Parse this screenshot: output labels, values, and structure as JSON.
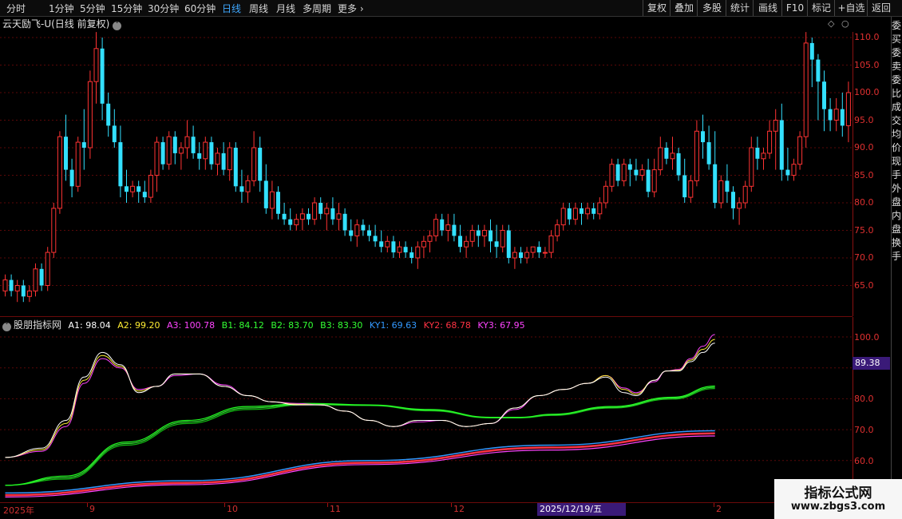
{
  "toolbar": {
    "periods": [
      "分时",
      "1分钟",
      "5分钟",
      "15分钟",
      "30分钟",
      "60分钟",
      "日线",
      "周线",
      "月线",
      "多周期",
      "更多"
    ],
    "active": "日线",
    "right_buttons": [
      "复权",
      "叠加",
      "多股",
      "统计",
      "画线",
      "F10",
      "标记",
      "+自选",
      "返回"
    ]
  },
  "main": {
    "title": "云天励飞-U(日线 前复权)",
    "ticks": [
      "110.0",
      "105.0",
      "100.0",
      "95.0",
      "90.0",
      "85.0",
      "80.0",
      "75.0",
      "70.0",
      "65.0"
    ]
  },
  "indicator": {
    "name": "股朋指标网",
    "values": [
      {
        "label": "A1: 98.04",
        "color": "#ffffff"
      },
      {
        "label": "A2: 99.20",
        "color": "#ffee33"
      },
      {
        "label": "A3: 100.78",
        "color": "#ff44ff"
      },
      {
        "label": "B1: 84.12",
        "color": "#33ff33"
      },
      {
        "label": "B2: 83.70",
        "color": "#33ff33"
      },
      {
        "label": "B3: 83.30",
        "color": "#33ff33"
      },
      {
        "label": "KY1: 69.63",
        "color": "#3399ff"
      },
      {
        "label": "KY2: 68.78",
        "color": "#ff3344"
      },
      {
        "label": "KY3: 67.95",
        "color": "#ff44ff"
      }
    ],
    "ticks": [
      "100.0",
      "90.0",
      "80.0",
      "70.0",
      "60.0"
    ],
    "current_value": "89.38"
  },
  "xaxis": {
    "labels": [
      {
        "text": "2025年"
      },
      {
        "text": "9"
      },
      {
        "text": "10"
      },
      {
        "text": "11"
      },
      {
        "text": "12"
      },
      {
        "text": "2"
      }
    ],
    "highlight_date": "2025/12/19/五"
  },
  "watermark": {
    "line1": "指标公式网",
    "line2": "www.zbgs3.com"
  },
  "side_panel_text": "委买委卖委比成交均价现手外盘内盘换手",
  "colors": {
    "up": "#ff3333",
    "down": "#33e0ff",
    "background": "#000000",
    "grid": "#5a0808",
    "accent": "#3fa8ff"
  },
  "chart_data": {
    "type": "candlestick",
    "candles_ohlc": [
      [
        64,
        67,
        63,
        66
      ],
      [
        66,
        67,
        63,
        64
      ],
      [
        64,
        66,
        62,
        65
      ],
      [
        65,
        66,
        62,
        63
      ],
      [
        63,
        65,
        62,
        64
      ],
      [
        64,
        69,
        63,
        68
      ],
      [
        68,
        69,
        64,
        65
      ],
      [
        65,
        72,
        64,
        71
      ],
      [
        71,
        80,
        70,
        79
      ],
      [
        79,
        93,
        78,
        92
      ],
      [
        92,
        96,
        84,
        86
      ],
      [
        86,
        88,
        81,
        83
      ],
      [
        83,
        92,
        82,
        91
      ],
      [
        91,
        97,
        86,
        90
      ],
      [
        90,
        104,
        88,
        102
      ],
      [
        102,
        111,
        98,
        108
      ],
      [
        108,
        110,
        95,
        98
      ],
      [
        98,
        100,
        92,
        94
      ],
      [
        94,
        97,
        90,
        91
      ],
      [
        91,
        94,
        81,
        83
      ],
      [
        83,
        86,
        80,
        82
      ],
      [
        82,
        84,
        81,
        83
      ],
      [
        83,
        84,
        80,
        82
      ],
      [
        82,
        84,
        80,
        81
      ],
      [
        81,
        86,
        80,
        85
      ],
      [
        85,
        92,
        82,
        91
      ],
      [
        91,
        92,
        86,
        87
      ],
      [
        87,
        93,
        86,
        92
      ],
      [
        92,
        93,
        87,
        89
      ],
      [
        89,
        91,
        86,
        90
      ],
      [
        90,
        95,
        88,
        92
      ],
      [
        92,
        94,
        88,
        89
      ],
      [
        89,
        91,
        86,
        88
      ],
      [
        88,
        92,
        86,
        91
      ],
      [
        91,
        92,
        86,
        87
      ],
      [
        87,
        90,
        85,
        89
      ],
      [
        89,
        91,
        85,
        86
      ],
      [
        86,
        91,
        84,
        90
      ],
      [
        90,
        91,
        82,
        83
      ],
      [
        83,
        86,
        80,
        82
      ],
      [
        82,
        85,
        80,
        84
      ],
      [
        84,
        93,
        83,
        90
      ],
      [
        90,
        92,
        82,
        84
      ],
      [
        84,
        87,
        78,
        79
      ],
      [
        79,
        84,
        77,
        82
      ],
      [
        82,
        83,
        77,
        78
      ],
      [
        78,
        80,
        76,
        77
      ],
      [
        77,
        79,
        75,
        76
      ],
      [
        76,
        78,
        75,
        77
      ],
      [
        77,
        79,
        75,
        78
      ],
      [
        78,
        79,
        76,
        77
      ],
      [
        77,
        81,
        76,
        80
      ],
      [
        80,
        81,
        77,
        78
      ],
      [
        78,
        80,
        75,
        79
      ],
      [
        79,
        81,
        76,
        77
      ],
      [
        77,
        80,
        75,
        78
      ],
      [
        78,
        79,
        74,
        75
      ],
      [
        75,
        77,
        73,
        74
      ],
      [
        74,
        77,
        72,
        76
      ],
      [
        76,
        77,
        74,
        75
      ],
      [
        75,
        76,
        73,
        74
      ],
      [
        74,
        76,
        72,
        73
      ],
      [
        73,
        75,
        71,
        72
      ],
      [
        72,
        74,
        71,
        73
      ],
      [
        73,
        74,
        70,
        71
      ],
      [
        71,
        73,
        70,
        72
      ],
      [
        72,
        73,
        70,
        71
      ],
      [
        71,
        72,
        69,
        70
      ],
      [
        70,
        73,
        68,
        72
      ],
      [
        72,
        74,
        70,
        73
      ],
      [
        73,
        75,
        71,
        74
      ],
      [
        74,
        78,
        73,
        77
      ],
      [
        77,
        78,
        74,
        75
      ],
      [
        75,
        78,
        73,
        76
      ],
      [
        76,
        78,
        73,
        74
      ],
      [
        74,
        76,
        71,
        72
      ],
      [
        72,
        74,
        70,
        73
      ],
      [
        73,
        76,
        72,
        75
      ],
      [
        75,
        76,
        72,
        74
      ],
      [
        74,
        76,
        72,
        75
      ],
      [
        75,
        77,
        71,
        73
      ],
      [
        73,
        76,
        70,
        72
      ],
      [
        72,
        76,
        71,
        75
      ],
      [
        75,
        76,
        69,
        70
      ],
      [
        70,
        72,
        68,
        71
      ],
      [
        71,
        72,
        69,
        70
      ],
      [
        70,
        72,
        69,
        71
      ],
      [
        71,
        72,
        70,
        72
      ],
      [
        72,
        73,
        70,
        71
      ],
      [
        71,
        72,
        70,
        71
      ],
      [
        71,
        75,
        70,
        74
      ],
      [
        74,
        77,
        73,
        76
      ],
      [
        76,
        80,
        75,
        79
      ],
      [
        79,
        80,
        76,
        77
      ],
      [
        77,
        80,
        76,
        79
      ],
      [
        79,
        80,
        76,
        78
      ],
      [
        78,
        80,
        77,
        79
      ],
      [
        79,
        80,
        77,
        78
      ],
      [
        78,
        81,
        77,
        80
      ],
      [
        80,
        84,
        79,
        83
      ],
      [
        83,
        88,
        82,
        87
      ],
      [
        87,
        88,
        83,
        84
      ],
      [
        84,
        88,
        83,
        87
      ],
      [
        87,
        88,
        83,
        86
      ],
      [
        86,
        88,
        84,
        85
      ],
      [
        85,
        87,
        84,
        86
      ],
      [
        86,
        88,
        81,
        82
      ],
      [
        82,
        88,
        81,
        86
      ],
      [
        86,
        92,
        85,
        90
      ],
      [
        90,
        91,
        87,
        88
      ],
      [
        88,
        92,
        86,
        89
      ],
      [
        89,
        90,
        84,
        85
      ],
      [
        85,
        88,
        80,
        81
      ],
      [
        81,
        85,
        80,
        84
      ],
      [
        84,
        95,
        83,
        93
      ],
      [
        93,
        96,
        88,
        91
      ],
      [
        91,
        94,
        86,
        87
      ],
      [
        87,
        93,
        79,
        80
      ],
      [
        80,
        85,
        79,
        84
      ],
      [
        84,
        87,
        80,
        82
      ],
      [
        82,
        83,
        77,
        79
      ],
      [
        79,
        81,
        76,
        80
      ],
      [
        80,
        84,
        79,
        83
      ],
      [
        83,
        92,
        82,
        90
      ],
      [
        90,
        92,
        86,
        88
      ],
      [
        88,
        90,
        86,
        89
      ],
      [
        89,
        95,
        88,
        93
      ],
      [
        93,
        97,
        86,
        95
      ],
      [
        95,
        98,
        84,
        86
      ],
      [
        86,
        90,
        84,
        85
      ],
      [
        85,
        88,
        84,
        87
      ],
      [
        87,
        93,
        86,
        92
      ],
      [
        92,
        111,
        90,
        109
      ],
      [
        109,
        110,
        101,
        106
      ],
      [
        106,
        107,
        95,
        102
      ],
      [
        102,
        104,
        93,
        97
      ],
      [
        97,
        99,
        93,
        95
      ],
      [
        95,
        99,
        93,
        97
      ],
      [
        97,
        100,
        92,
        94
      ],
      [
        94,
        102,
        91,
        100
      ]
    ],
    "ind_series": {
      "A1": [
        [
          0,
          61
        ],
        [
          6,
          64
        ],
        [
          10,
          73
        ],
        [
          13,
          87
        ],
        [
          16,
          95
        ],
        [
          19,
          91
        ],
        [
          22,
          82
        ],
        [
          25,
          84
        ],
        [
          28,
          88
        ],
        [
          32,
          88
        ],
        [
          36,
          84
        ],
        [
          40,
          81
        ],
        [
          44,
          79
        ],
        [
          48,
          78
        ],
        [
          52,
          78
        ],
        [
          56,
          76
        ],
        [
          60,
          73
        ],
        [
          64,
          71
        ],
        [
          68,
          73
        ],
        [
          72,
          73
        ],
        [
          76,
          71
        ],
        [
          80,
          72
        ],
        [
          84,
          77
        ],
        [
          88,
          81
        ],
        [
          92,
          83
        ],
        [
          96,
          85
        ],
        [
          99,
          87
        ],
        [
          102,
          82
        ],
        [
          104,
          81
        ],
        [
          107,
          86
        ],
        [
          109,
          89
        ],
        [
          111,
          89
        ],
        [
          113,
          92
        ],
        [
          115,
          95
        ],
        [
          117,
          98
        ]
      ],
      "A2": [
        [
          0,
          61
        ],
        [
          6,
          63.5
        ],
        [
          10,
          72
        ],
        [
          13,
          86
        ],
        [
          16,
          94
        ],
        [
          19,
          90.5
        ],
        [
          22,
          82.5
        ],
        [
          25,
          84
        ],
        [
          28,
          88
        ],
        [
          32,
          88
        ],
        [
          36,
          84
        ],
        [
          40,
          81
        ],
        [
          44,
          79
        ],
        [
          48,
          78.2
        ],
        [
          52,
          78
        ],
        [
          56,
          76
        ],
        [
          60,
          73
        ],
        [
          64,
          71
        ],
        [
          68,
          73
        ],
        [
          72,
          73
        ],
        [
          76,
          71
        ],
        [
          80,
          72
        ],
        [
          84,
          77
        ],
        [
          88,
          81
        ],
        [
          92,
          83
        ],
        [
          96,
          85
        ],
        [
          99,
          87.5
        ],
        [
          102,
          83
        ],
        [
          104,
          81.5
        ],
        [
          107,
          86
        ],
        [
          109,
          89
        ],
        [
          111,
          89.2
        ],
        [
          113,
          92.5
        ],
        [
          115,
          96
        ],
        [
          117,
          99.2
        ]
      ],
      "A3": [
        [
          0,
          61
        ],
        [
          6,
          63
        ],
        [
          10,
          71
        ],
        [
          13,
          85
        ],
        [
          16,
          93
        ],
        [
          19,
          90
        ],
        [
          22,
          83
        ],
        [
          25,
          84
        ],
        [
          28,
          87.5
        ],
        [
          32,
          88
        ],
        [
          36,
          84.5
        ],
        [
          40,
          81
        ],
        [
          44,
          79
        ],
        [
          48,
          78.5
        ],
        [
          52,
          78
        ],
        [
          56,
          76
        ],
        [
          60,
          73
        ],
        [
          64,
          71
        ],
        [
          68,
          72.5
        ],
        [
          72,
          73
        ],
        [
          76,
          71
        ],
        [
          80,
          72
        ],
        [
          84,
          76.5
        ],
        [
          88,
          81
        ],
        [
          92,
          83
        ],
        [
          96,
          85
        ],
        [
          99,
          87.5
        ],
        [
          102,
          83.5
        ],
        [
          104,
          82
        ],
        [
          107,
          85.5
        ],
        [
          109,
          89
        ],
        [
          111,
          89.5
        ],
        [
          113,
          93
        ],
        [
          115,
          97
        ],
        [
          117,
          100.78
        ]
      ],
      "B1": [
        [
          0,
          52
        ],
        [
          10,
          55
        ],
        [
          20,
          66
        ],
        [
          30,
          73
        ],
        [
          40,
          77.5
        ],
        [
          50,
          78.5
        ],
        [
          60,
          78
        ],
        [
          70,
          76.5
        ],
        [
          80,
          74
        ],
        [
          85,
          74
        ],
        [
          90,
          75
        ],
        [
          100,
          77.5
        ],
        [
          110,
          80.5
        ],
        [
          117,
          84.12
        ]
      ],
      "B2": [
        [
          0,
          52
        ],
        [
          10,
          54.5
        ],
        [
          20,
          65.5
        ],
        [
          30,
          72.5
        ],
        [
          40,
          77
        ],
        [
          50,
          78.3
        ],
        [
          60,
          77.9
        ],
        [
          70,
          76.3
        ],
        [
          80,
          73.9
        ],
        [
          85,
          73.9
        ],
        [
          90,
          74.8
        ],
        [
          100,
          77.2
        ],
        [
          110,
          80.2
        ],
        [
          117,
          83.7
        ]
      ],
      "B3": [
        [
          0,
          52
        ],
        [
          10,
          54
        ],
        [
          20,
          65
        ],
        [
          30,
          72
        ],
        [
          40,
          76.5
        ],
        [
          50,
          78.1
        ],
        [
          60,
          77.8
        ],
        [
          70,
          76.1
        ],
        [
          80,
          73.8
        ],
        [
          85,
          73.8
        ],
        [
          90,
          74.6
        ],
        [
          100,
          77
        ],
        [
          110,
          79.9
        ],
        [
          117,
          83.3
        ]
      ],
      "KY1": [
        [
          0,
          49.5
        ],
        [
          30,
          53.5
        ],
        [
          60,
          60
        ],
        [
          90,
          65
        ],
        [
          117,
          69.63
        ]
      ],
      "KY2": [
        [
          0,
          48.8
        ],
        [
          30,
          52.8
        ],
        [
          60,
          59.3
        ],
        [
          90,
          64.2
        ],
        [
          117,
          68.78
        ]
      ],
      "KY3": [
        [
          0,
          48.2
        ],
        [
          30,
          52.2
        ],
        [
          60,
          58.7
        ],
        [
          90,
          63.4
        ],
        [
          117,
          67.95
        ]
      ]
    }
  }
}
